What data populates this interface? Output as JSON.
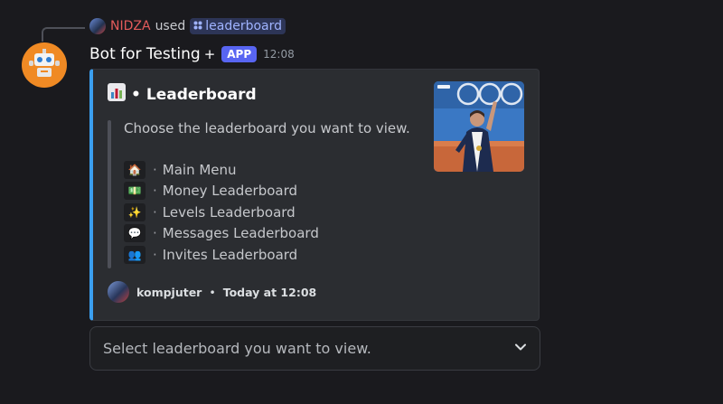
{
  "reply": {
    "user_name": "NIDZA",
    "used_label": "used",
    "command_icon": "command-icon",
    "command_name": "leaderboard"
  },
  "message": {
    "bot_name": "Bot for Testing",
    "plus": "+",
    "app_badge": "APP",
    "timestamp": "12:08"
  },
  "embed": {
    "accent_color": "#3b9ff0",
    "title_icon": "bar-chart-icon",
    "title_prefix": "•",
    "title": "Leaderboard",
    "description": "Choose the leaderboard you want to view.",
    "items": [
      {
        "icon": "house-emoji",
        "emoji": "🏠",
        "label": "Main Menu"
      },
      {
        "icon": "money-emoji",
        "emoji": "💵",
        "label": "Money Leaderboard"
      },
      {
        "icon": "sparkles-emoji",
        "emoji": "✨",
        "label": "Levels Leaderboard"
      },
      {
        "icon": "speech-bubble-emoji",
        "emoji": "💬",
        "label": "Messages Leaderboard"
      },
      {
        "icon": "people-emoji",
        "emoji": "👥",
        "label": "Invites Leaderboard"
      }
    ],
    "footer_user": "kompjuter",
    "footer_separator": "•",
    "footer_time": "Today at 12:08"
  },
  "select_menu": {
    "placeholder": "Select leaderboard you want to view.",
    "icon": "chevron-down-icon"
  }
}
